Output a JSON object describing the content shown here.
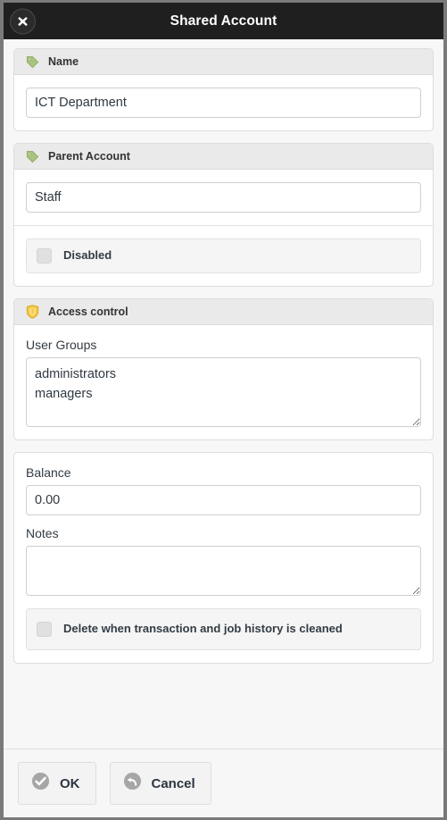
{
  "window": {
    "title": "Shared Account",
    "close_icon": "close-icon"
  },
  "sections": {
    "name": {
      "icon": "tag-icon",
      "header": "Name",
      "value": "ICT Department"
    },
    "parent_account": {
      "icon": "tag-icon",
      "header": "Parent Account",
      "value": "Staff",
      "disabled_label": "Disabled",
      "disabled_checked": false
    },
    "access_control": {
      "icon": "shield-icon",
      "header": "Access control",
      "user_groups_label": "User Groups",
      "user_groups_value": "administrators\nmanagers"
    },
    "details": {
      "balance_label": "Balance",
      "balance_value": "0.00",
      "notes_label": "Notes",
      "notes_value": "",
      "delete_label": "Delete when transaction and job history is cleaned",
      "delete_checked": false
    }
  },
  "footer": {
    "ok_label": "OK",
    "ok_icon": "check-circle-icon",
    "cancel_label": "Cancel",
    "cancel_icon": "undo-circle-icon"
  },
  "colors": {
    "titlebar": "#1f1f1f",
    "page_background": "#f7f7f7",
    "section_header": "#eaeaea",
    "shield_gold": "#f0c040",
    "tag_green": "#9cbf6e"
  }
}
